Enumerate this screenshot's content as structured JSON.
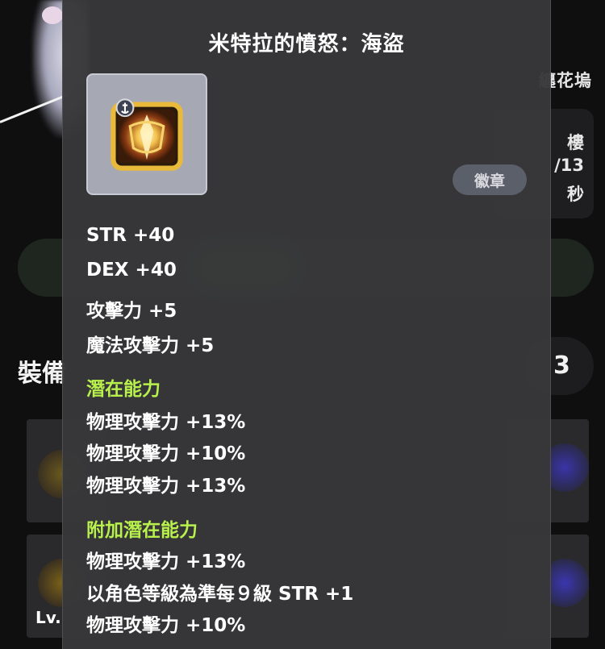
{
  "background": {
    "right_title": "纏花塢",
    "info_lines": [
      "樓",
      "/13",
      "秒"
    ],
    "section_title": "裝備",
    "count": "3",
    "slot_level": "Lv."
  },
  "tooltip": {
    "title": "米特拉的憤怒：海盜",
    "item_type": "徽章",
    "base_stats": [
      "STR +40",
      "DEX +40",
      "攻擊力 +5",
      "魔法攻擊力 +5"
    ],
    "potential": {
      "label": "潛在能力",
      "lines": [
        "物理攻擊力 +13%",
        "物理攻擊力 +10%",
        "物理攻擊力 +13%"
      ]
    },
    "bonus_potential": {
      "label": "附加潛在能力",
      "lines": [
        "物理攻擊力 +13%",
        "以角色等級為準每９級 STR +1",
        "物理攻擊力 +10%"
      ]
    }
  },
  "colors": {
    "panel": "#38383a",
    "section_header": "#b8f04c",
    "item_frame": "#a6a9b3",
    "type_pill": "#5b5f6a"
  },
  "icons": {
    "item": "pirate-emblem-icon"
  }
}
